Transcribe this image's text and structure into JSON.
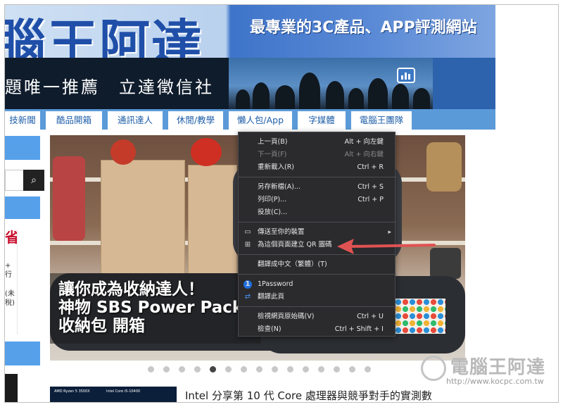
{
  "site": {
    "logo_text": "腦王阿達",
    "tagline": "最專業的3C產品、APP評測網站",
    "slogan": "題唯一推薦　立達徵信社"
  },
  "nav": {
    "tabs": [
      "技新聞",
      "酷品開箱",
      "通訊達人",
      "休閒/教學",
      "懶人包/App",
      "字媒體",
      "電腦王團隊"
    ]
  },
  "sidebar": {
    "search_icon": "search-icon",
    "ad_text": [
      "省",
      "+",
      "行",
      "(未",
      "稅)"
    ]
  },
  "slider": {
    "caption_lines": [
      "讓你成為收納達人！",
      "神物 SBS Power Pack",
      "收納包 開箱"
    ],
    "dot_count": 15,
    "active_dot": 5
  },
  "article": {
    "headline": "Intel 分享第 10 代 Core 處理器與競爭對手的實測數",
    "thumb_labels": [
      "AMD Ryzen 5 3500X",
      "Intel Core i5-10400"
    ]
  },
  "watermark": {
    "title": "電腦王阿達",
    "url": "http://www.kocpc.com.tw"
  },
  "context_menu": {
    "items": [
      {
        "label": "上一頁(B)",
        "shortcut": "Alt + 向左鍵",
        "disabled": false
      },
      {
        "label": "下一頁(F)",
        "shortcut": "Alt + 向右鍵",
        "disabled": true
      },
      {
        "label": "重新載入(R)",
        "shortcut": "Ctrl + R",
        "disabled": false
      },
      {
        "label": "另存新檔(A)...",
        "shortcut": "Ctrl + S",
        "disabled": false
      },
      {
        "label": "列印(P)...",
        "shortcut": "Ctrl + P",
        "disabled": false
      },
      {
        "label": "投放(C)...",
        "shortcut": "",
        "disabled": false
      },
      {
        "label": "傳送至你的裝置",
        "shortcut": "",
        "disabled": false,
        "icon": "device-icon",
        "submenu": true
      },
      {
        "label": "為這個頁面建立 QR 圖碼",
        "shortcut": "",
        "disabled": false,
        "icon": "qr-code-icon"
      },
      {
        "label": "翻譯成中文（繁體）(T)",
        "shortcut": "",
        "disabled": false
      },
      {
        "label": "1Password",
        "shortcut": "",
        "disabled": false,
        "icon": "1password-icon"
      },
      {
        "label": "翻譯此頁",
        "shortcut": "",
        "disabled": false,
        "icon": "translate-icon"
      },
      {
        "label": "檢視網頁原始碼(V)",
        "shortcut": "Ctrl + U",
        "disabled": false
      },
      {
        "label": "檢查(N)",
        "shortcut": "Ctrl + Shift + I",
        "disabled": false
      }
    ]
  },
  "colors": {
    "nav_blue": "#5a9ad8",
    "menu_bg": "#2b2b2e",
    "arrow_red": "#e05252"
  }
}
